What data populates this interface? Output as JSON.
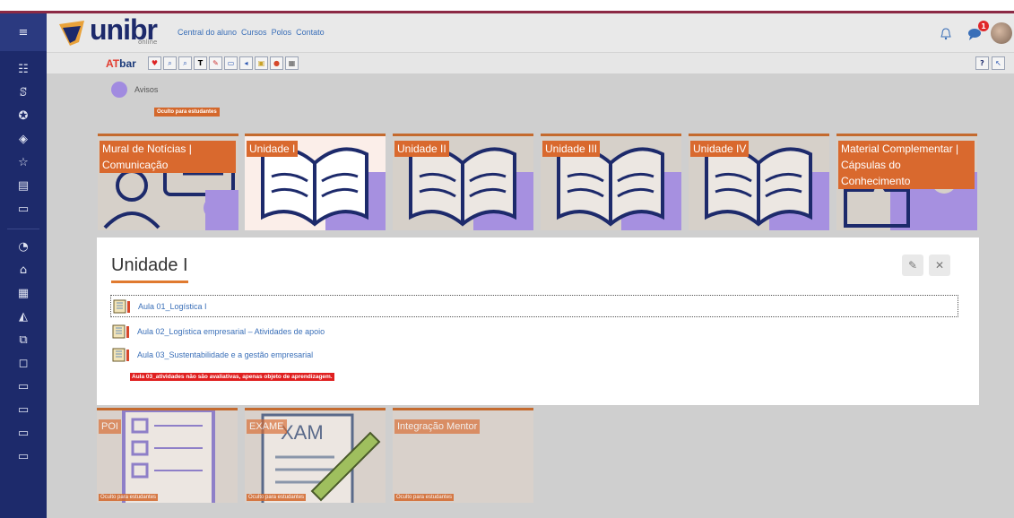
{
  "header": {
    "logo_text": "unibr",
    "logo_sub": "online",
    "nav": [
      "Central do aluno",
      "Cursos",
      "Polos",
      "Contato"
    ],
    "notification_badge": "1"
  },
  "atbar": {
    "logo_a": "AT",
    "logo_b": "bar",
    "buttons": [
      "heart-icon",
      "zoom-out-icon",
      "zoom-in-icon",
      "font-icon",
      "spellcheck-icon",
      "dictionary-icon",
      "text-to-speech-icon",
      "color-icon",
      "settings-icon",
      "close-icon"
    ]
  },
  "main": {
    "avisos_label": "Avisos",
    "oculto_label": "Oculto para estudantes",
    "tiles": [
      {
        "label": "Mural de Notícias | Comunicação"
      },
      {
        "label": "Unidade I"
      },
      {
        "label": "Unidade II"
      },
      {
        "label": "Unidade III"
      },
      {
        "label": "Unidade IV"
      },
      {
        "label": "Material Complementar | Cápsulas do Conhecimento"
      }
    ],
    "bottom_tiles": [
      {
        "label": "POI",
        "oculto": "Oculto para estudantes"
      },
      {
        "label": "EXAME",
        "oculto": "Oculto para estudantes"
      },
      {
        "label": "Integração Mentor",
        "oculto": "Oculto para estudantes"
      }
    ]
  },
  "panel": {
    "title": "Unidade I",
    "activities": [
      "Aula 01_Logística I",
      "Aula 02_Logística empresarial – Atividades de apoio",
      "Aula 03_Sustentabilidade e a gestão empresarial"
    ],
    "warning": "Aula 03_atividades não são avaliativas, apenas objeto de aprendizagem."
  },
  "colors": {
    "sidebar": "#1d2a6b",
    "accent": "#d9692e",
    "link": "#3a6fb8",
    "brand": "#1d2a6b"
  }
}
